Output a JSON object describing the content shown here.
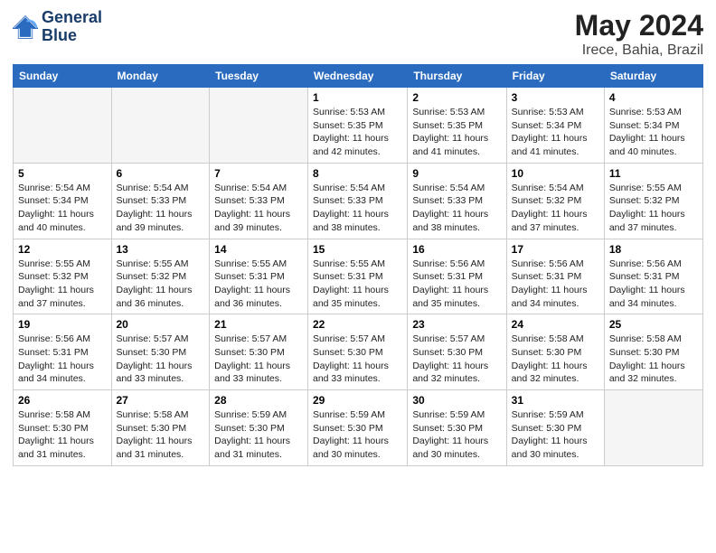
{
  "logo": {
    "line1": "General",
    "line2": "Blue"
  },
  "title": "May 2024",
  "location": "Irece, Bahia, Brazil",
  "weekdays": [
    "Sunday",
    "Monday",
    "Tuesday",
    "Wednesday",
    "Thursday",
    "Friday",
    "Saturday"
  ],
  "weeks": [
    [
      {
        "day": "",
        "info": ""
      },
      {
        "day": "",
        "info": ""
      },
      {
        "day": "",
        "info": ""
      },
      {
        "day": "1",
        "info": "Sunrise: 5:53 AM\nSunset: 5:35 PM\nDaylight: 11 hours\nand 42 minutes."
      },
      {
        "day": "2",
        "info": "Sunrise: 5:53 AM\nSunset: 5:35 PM\nDaylight: 11 hours\nand 41 minutes."
      },
      {
        "day": "3",
        "info": "Sunrise: 5:53 AM\nSunset: 5:34 PM\nDaylight: 11 hours\nand 41 minutes."
      },
      {
        "day": "4",
        "info": "Sunrise: 5:53 AM\nSunset: 5:34 PM\nDaylight: 11 hours\nand 40 minutes."
      }
    ],
    [
      {
        "day": "5",
        "info": "Sunrise: 5:54 AM\nSunset: 5:34 PM\nDaylight: 11 hours\nand 40 minutes."
      },
      {
        "day": "6",
        "info": "Sunrise: 5:54 AM\nSunset: 5:33 PM\nDaylight: 11 hours\nand 39 minutes."
      },
      {
        "day": "7",
        "info": "Sunrise: 5:54 AM\nSunset: 5:33 PM\nDaylight: 11 hours\nand 39 minutes."
      },
      {
        "day": "8",
        "info": "Sunrise: 5:54 AM\nSunset: 5:33 PM\nDaylight: 11 hours\nand 38 minutes."
      },
      {
        "day": "9",
        "info": "Sunrise: 5:54 AM\nSunset: 5:33 PM\nDaylight: 11 hours\nand 38 minutes."
      },
      {
        "day": "10",
        "info": "Sunrise: 5:54 AM\nSunset: 5:32 PM\nDaylight: 11 hours\nand 37 minutes."
      },
      {
        "day": "11",
        "info": "Sunrise: 5:55 AM\nSunset: 5:32 PM\nDaylight: 11 hours\nand 37 minutes."
      }
    ],
    [
      {
        "day": "12",
        "info": "Sunrise: 5:55 AM\nSunset: 5:32 PM\nDaylight: 11 hours\nand 37 minutes."
      },
      {
        "day": "13",
        "info": "Sunrise: 5:55 AM\nSunset: 5:32 PM\nDaylight: 11 hours\nand 36 minutes."
      },
      {
        "day": "14",
        "info": "Sunrise: 5:55 AM\nSunset: 5:31 PM\nDaylight: 11 hours\nand 36 minutes."
      },
      {
        "day": "15",
        "info": "Sunrise: 5:55 AM\nSunset: 5:31 PM\nDaylight: 11 hours\nand 35 minutes."
      },
      {
        "day": "16",
        "info": "Sunrise: 5:56 AM\nSunset: 5:31 PM\nDaylight: 11 hours\nand 35 minutes."
      },
      {
        "day": "17",
        "info": "Sunrise: 5:56 AM\nSunset: 5:31 PM\nDaylight: 11 hours\nand 34 minutes."
      },
      {
        "day": "18",
        "info": "Sunrise: 5:56 AM\nSunset: 5:31 PM\nDaylight: 11 hours\nand 34 minutes."
      }
    ],
    [
      {
        "day": "19",
        "info": "Sunrise: 5:56 AM\nSunset: 5:31 PM\nDaylight: 11 hours\nand 34 minutes."
      },
      {
        "day": "20",
        "info": "Sunrise: 5:57 AM\nSunset: 5:30 PM\nDaylight: 11 hours\nand 33 minutes."
      },
      {
        "day": "21",
        "info": "Sunrise: 5:57 AM\nSunset: 5:30 PM\nDaylight: 11 hours\nand 33 minutes."
      },
      {
        "day": "22",
        "info": "Sunrise: 5:57 AM\nSunset: 5:30 PM\nDaylight: 11 hours\nand 33 minutes."
      },
      {
        "day": "23",
        "info": "Sunrise: 5:57 AM\nSunset: 5:30 PM\nDaylight: 11 hours\nand 32 minutes."
      },
      {
        "day": "24",
        "info": "Sunrise: 5:58 AM\nSunset: 5:30 PM\nDaylight: 11 hours\nand 32 minutes."
      },
      {
        "day": "25",
        "info": "Sunrise: 5:58 AM\nSunset: 5:30 PM\nDaylight: 11 hours\nand 32 minutes."
      }
    ],
    [
      {
        "day": "26",
        "info": "Sunrise: 5:58 AM\nSunset: 5:30 PM\nDaylight: 11 hours\nand 31 minutes."
      },
      {
        "day": "27",
        "info": "Sunrise: 5:58 AM\nSunset: 5:30 PM\nDaylight: 11 hours\nand 31 minutes."
      },
      {
        "day": "28",
        "info": "Sunrise: 5:59 AM\nSunset: 5:30 PM\nDaylight: 11 hours\nand 31 minutes."
      },
      {
        "day": "29",
        "info": "Sunrise: 5:59 AM\nSunset: 5:30 PM\nDaylight: 11 hours\nand 30 minutes."
      },
      {
        "day": "30",
        "info": "Sunrise: 5:59 AM\nSunset: 5:30 PM\nDaylight: 11 hours\nand 30 minutes."
      },
      {
        "day": "31",
        "info": "Sunrise: 5:59 AM\nSunset: 5:30 PM\nDaylight: 11 hours\nand 30 minutes."
      },
      {
        "day": "",
        "info": ""
      }
    ]
  ]
}
